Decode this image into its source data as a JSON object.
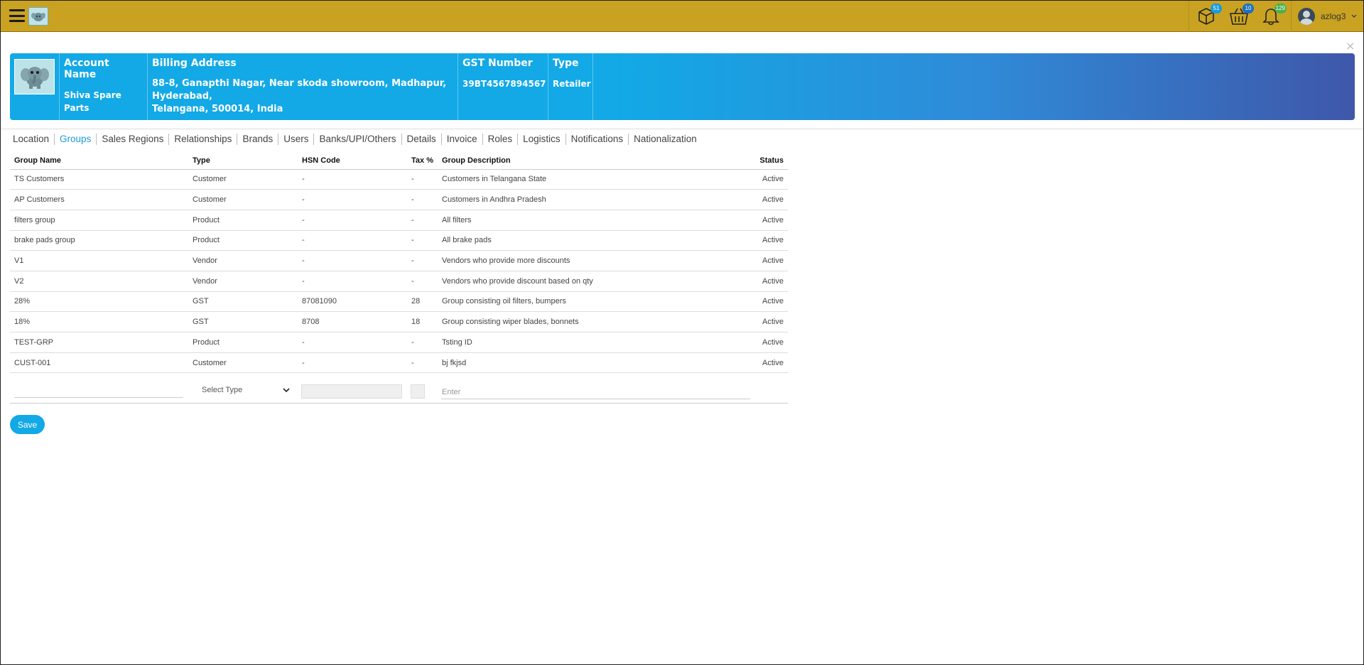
{
  "header": {
    "menu_icon": "hamburger-icon",
    "logo_icon": "elephant-logo-icon",
    "icons": [
      {
        "name": "cube-icon",
        "badge": "51",
        "badge_color": "#1a9bd8"
      },
      {
        "name": "basket-icon",
        "badge": "10",
        "badge_color": "#1a6fc0"
      },
      {
        "name": "bell-icon",
        "badge": "129",
        "badge_color": "#4caf50"
      }
    ],
    "username": "azlog3",
    "bar_color": "#c9a221"
  },
  "close_label": "×",
  "account": {
    "headers": {
      "name": "Account Name",
      "billing": "Billing Address",
      "gst": "GST Number",
      "type": "Type"
    },
    "name": "Shiva Spare Parts",
    "billing_line1": "88-8, Ganapthi Nagar, Near skoda showroom, Madhapur,",
    "billing_line2": "Hyderabad,",
    "billing_line3": "Telangana, 500014, India",
    "gst": "39BT4567894567",
    "type": "Retailer",
    "banner_colors": [
      "#12a9e6",
      "#3f57aa"
    ]
  },
  "tabs": [
    "Location",
    "Groups",
    "Sales Regions",
    "Relationships",
    "Brands",
    "Users",
    "Banks/UPI/Others",
    "Details",
    "Invoice",
    "Roles",
    "Logistics",
    "Notifications",
    "Nationalization"
  ],
  "active_tab": "Groups",
  "table": {
    "headers": [
      "Group Name",
      "Type",
      "HSN Code",
      "Tax %",
      "Group Description",
      "Status"
    ],
    "rows": [
      [
        "TS Customers",
        "Customer",
        "-",
        "-",
        "Customers in Telangana State",
        "Active"
      ],
      [
        "AP Customers",
        "Customer",
        "-",
        "-",
        "Customers in Andhra Pradesh",
        "Active"
      ],
      [
        "filters group",
        "Product",
        "-",
        "-",
        "All filters",
        "Active"
      ],
      [
        "brake pads group",
        "Product",
        "-",
        "-",
        "All brake pads",
        "Active"
      ],
      [
        "V1",
        "Vendor",
        "-",
        "-",
        "Vendors who provide more discounts",
        "Active"
      ],
      [
        "V2",
        "Vendor",
        "-",
        "-",
        "Vendors who provide discount based on qty",
        "Active"
      ],
      [
        "28%",
        "GST",
        "87081090",
        "28",
        "Group consisting oil filters, bumpers",
        "Active"
      ],
      [
        "18%",
        "GST",
        "8708",
        "18",
        "Group consisting wiper blades, bonnets",
        "Active"
      ],
      [
        "TEST-GRP",
        "Product",
        "-",
        "-",
        "Tsting ID",
        "Active"
      ],
      [
        "CUST-001",
        "Customer",
        "-",
        "-",
        "bj fkjsd",
        "Active"
      ]
    ]
  },
  "form": {
    "select_type_label": "Select Type",
    "desc_placeholder": "Enter",
    "save_label": "Save"
  }
}
